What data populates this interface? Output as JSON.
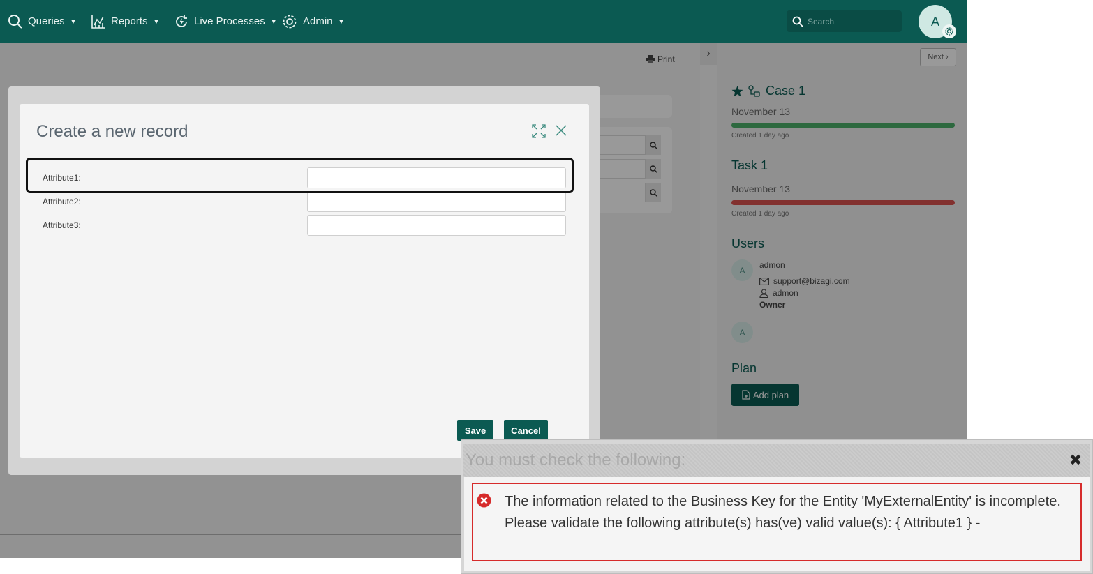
{
  "nav": {
    "items": [
      {
        "label": "Queries",
        "icon": "search-icon"
      },
      {
        "label": "Reports",
        "icon": "chart-icon"
      },
      {
        "label": "Live Processes",
        "icon": "live-process-icon"
      },
      {
        "label": "Admin",
        "icon": "gear-icon"
      }
    ],
    "search_placeholder": "Search",
    "avatar_letter": "A"
  },
  "toolbar": {
    "print_label": "Print",
    "next_label": "Next"
  },
  "case_panel": {
    "case": {
      "title": "Case 1",
      "date": "November 13",
      "created": "Created 1 day ago",
      "bar_color": "#4caf6a"
    },
    "task": {
      "title": "Task 1",
      "date": "November 13",
      "created": "Created 1 day ago",
      "bar_color": "#d9534f"
    },
    "users_heading": "Users",
    "users": [
      {
        "avatar": "A",
        "name": "admon",
        "email": "support@bizagi.com",
        "login": "admon",
        "role": "Owner"
      },
      {
        "avatar": "A"
      }
    ],
    "plan_heading": "Plan",
    "add_plan_label": "Add plan"
  },
  "modal": {
    "title": "Create a new record",
    "fields": [
      {
        "label": "Attribute1:",
        "value": ""
      },
      {
        "label": "Attribute2:",
        "value": ""
      },
      {
        "label": "Attribute3:",
        "value": ""
      }
    ],
    "save_label": "Save",
    "cancel_label": "Cancel"
  },
  "error_dialog": {
    "title": "You must check the following:",
    "message": "The information related to the Business Key for the Entity 'MyExternalEntity' is incomplete. Please validate the following attribute(s) has(ve) valid value(s): { Attribute1 } -",
    "accent_color": "#d62b2b"
  },
  "colors": {
    "brand": "#0b5a52"
  }
}
